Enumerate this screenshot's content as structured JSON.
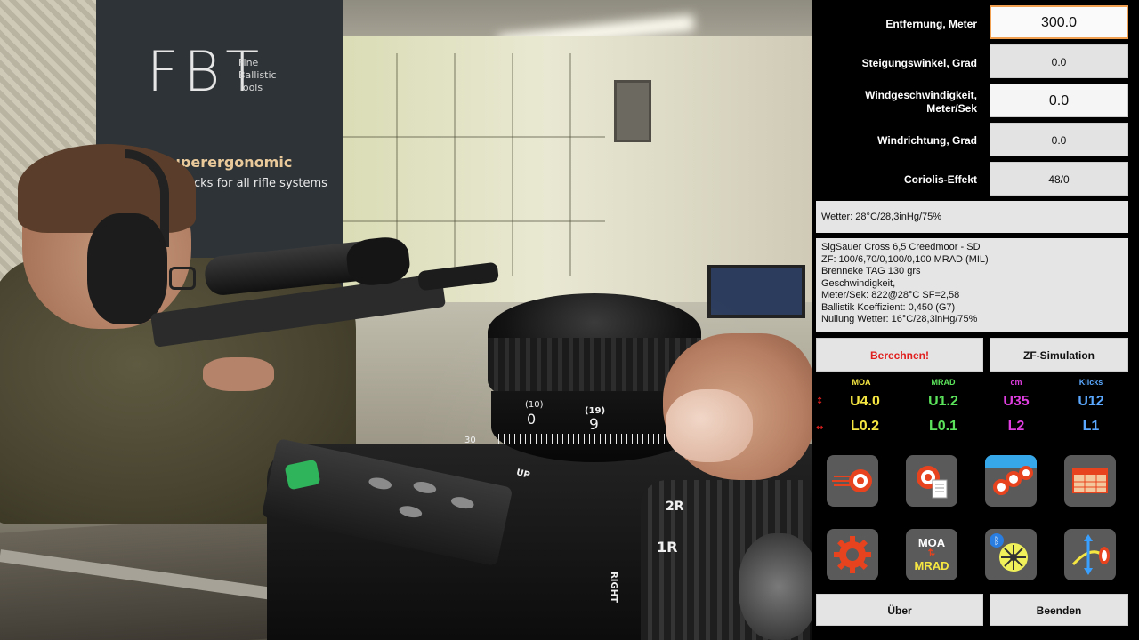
{
  "photo": {
    "banner_logo": "FBT",
    "banner_sub": [
      "Fine",
      "Ballistic",
      "Tools"
    ],
    "banner_line1": "Superergonomic",
    "banner_line2": "cks for all rifle systems",
    "dial_labels": [
      "(10)",
      "0",
      "(19)",
      "9"
    ],
    "scope_labels": [
      "2R",
      "1R",
      "RIGHT",
      "UP",
      "30"
    ]
  },
  "inputs": {
    "distance": {
      "label": "Entfernung, Meter",
      "value": "300.0"
    },
    "incline": {
      "label": "Steigungswinkel, Grad",
      "value": "0.0"
    },
    "wind_speed": {
      "label_line1": "Windgeschwindigkeit,",
      "label_line2": "Meter/Sek",
      "value": "0.0"
    },
    "wind_dir": {
      "label": "Windrichtung, Grad",
      "value": "0.0"
    },
    "coriolis": {
      "label": "Coriolis-Effekt",
      "value": "48/0"
    }
  },
  "weather": "Wetter: 28°C/28,3inHg/75%",
  "profile_lines": [
    "SigSauer Cross 6,5 Creedmoor - SD",
    "ZF: 100/6,70/0,100/0,100 MRAD (MIL)",
    "Brenneke TAG 130 grs",
    "Geschwindigkeit,",
    "Meter/Sek: 822@28°C SF=2,58",
    "Ballistik Koeffizient: 0,450 (G7)",
    "Nullung Wetter: 16°C/28,3inHg/75%"
  ],
  "buttons": {
    "calculate": "Berechnen!",
    "scope_sim": "ZF-Simulation",
    "about": "Über",
    "quit": "Beenden"
  },
  "results": {
    "columns": [
      {
        "header": "MOA",
        "color": "#f5e642",
        "vertical": "U4.0",
        "horizontal": "L0.2"
      },
      {
        "header": "MRAD",
        "color": "#5be35b",
        "vertical": "U1.2",
        "horizontal": "L0.1"
      },
      {
        "header": "cm",
        "color": "#e03ee0",
        "vertical": "U35",
        "horizontal": "L2"
      },
      {
        "header": "Klicks",
        "color": "#5aa8ff",
        "vertical": "U12",
        "horizontal": "L1"
      }
    ],
    "vertical_arrow": "↕",
    "horizontal_arrow": "↔"
  },
  "tiles": {
    "moa_mrad_top": "MOA",
    "moa_mrad_bottom": "MRAD",
    "icon_names": [
      "fast-target-icon",
      "target-report-icon",
      "multi-target-icon",
      "table-icon",
      "settings-gear-icon",
      "moa-mrad-icon",
      "bluetooth-wind-icon",
      "angle-target-icon"
    ]
  },
  "colors": {
    "accent_orange": "#f0a050",
    "calculate_red": "#e0201e",
    "icon_red": "#e8431f",
    "tile_grey": "#5a5a5a",
    "field_grey": "#e3e3e3"
  }
}
